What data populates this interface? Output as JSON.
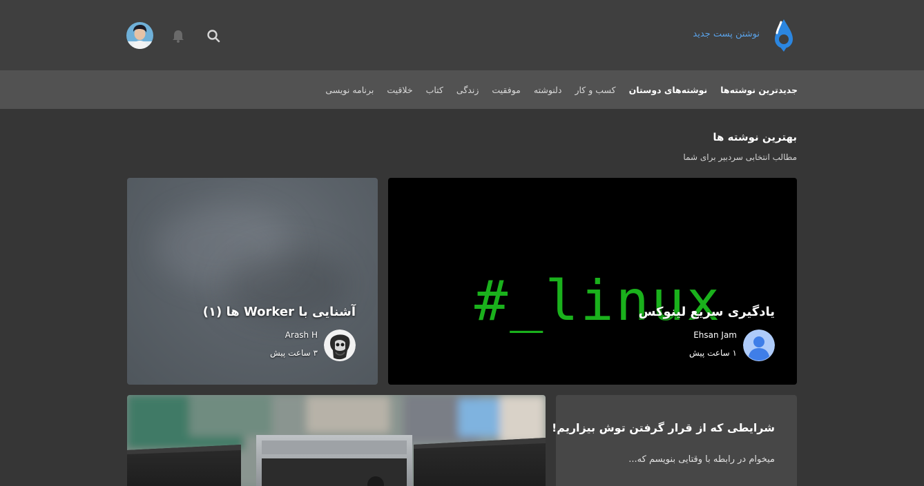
{
  "header": {
    "new_post_label": "نوشتن پست جدید",
    "accent_color": "#5aa2e8"
  },
  "categories": [
    {
      "label": "جدیدترین نوشته‌ها",
      "active": true
    },
    {
      "label": "نوشته‌های دوستان",
      "active": true
    },
    {
      "label": "کسب و کار",
      "active": false
    },
    {
      "label": "دلنوشته",
      "active": false
    },
    {
      "label": "موفقیت",
      "active": false
    },
    {
      "label": "زندگی",
      "active": false
    },
    {
      "label": "کتاب",
      "active": false
    },
    {
      "label": "خلاقیت",
      "active": false
    },
    {
      "label": "برنامه نویسی",
      "active": false
    }
  ],
  "featured": {
    "title": "بهترین نوشته ها",
    "subtitle": "مطالب انتخابی سردبیر برای شما"
  },
  "posts": [
    {
      "title": "یادگیری سریع لینوکس",
      "author": "Ehsan Jam",
      "time": "۱ ساعت پیش",
      "image_text": "#_linux"
    },
    {
      "title": "آشنایی با Worker ها (۱)",
      "author": "Arash H",
      "time": "۳ ساعت پیش"
    },
    {
      "title": "شرایطی که از قرار گرفتن توش بیزاریم!",
      "excerpt": "میخوام در رابطه با وقتایی بنویسم که..."
    }
  ]
}
